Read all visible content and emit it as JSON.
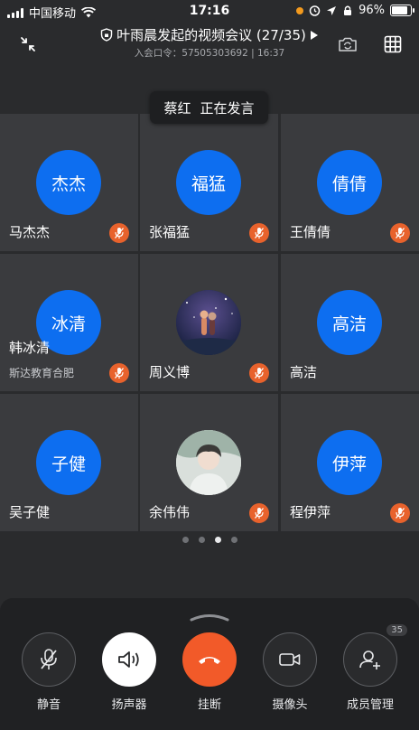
{
  "status_bar": {
    "carrier": "中国移动",
    "time": "17:16",
    "battery": "96%",
    "battery_level": 0.96
  },
  "header": {
    "title": "叶雨晨发起的视频会议 (27/35)",
    "subtitle": "入会口令：57505303692 | 16:37"
  },
  "speaking_toast": {
    "name": "蔡红",
    "status": "正在发言"
  },
  "participants": [
    {
      "avatar_text": "杰杰",
      "name": "马杰杰",
      "muted": true
    },
    {
      "avatar_text": "福猛",
      "name": "张福猛",
      "muted": true
    },
    {
      "avatar_text": "倩倩",
      "name": "王倩倩",
      "muted": true
    },
    {
      "avatar_text": "冰清",
      "name": "韩冰清",
      "subtitle": "斯达教育合肥",
      "muted": true
    },
    {
      "avatar_text": "",
      "avatar_image": "anime-photo",
      "name": "周义博",
      "muted": true
    },
    {
      "avatar_text": "高洁",
      "name": "高洁",
      "muted": false
    },
    {
      "avatar_text": "子健",
      "name": "吴子健",
      "muted": false
    },
    {
      "avatar_text": "",
      "avatar_image": "photo",
      "name": "余伟伟",
      "muted": true
    },
    {
      "avatar_text": "伊萍",
      "name": "程伊萍",
      "muted": true
    }
  ],
  "pagination": {
    "pages": 4,
    "current": 3
  },
  "controls": {
    "mute_label": "静音",
    "speaker_label": "扬声器",
    "hangup_label": "挂断",
    "camera_label": "摄像头",
    "members_label": "成员管理",
    "members_count": "35"
  },
  "colors": {
    "avatar_blue": "#0d6ef0",
    "mic_badge": "#e8622c",
    "hangup_red": "#f25a29",
    "tile_bg": "#3a3b3e",
    "page_bg": "#2a2b2d"
  },
  "icons": [
    "signal-icon",
    "wifi-icon",
    "alarm-icon",
    "location-icon",
    "lock-icon",
    "battery-icon",
    "collapse-icon",
    "shield-icon",
    "play-icon",
    "camera-switch-icon",
    "grid-icon",
    "mic-muted-icon",
    "mic-off-icon",
    "speaker-icon",
    "hangup-icon",
    "video-camera-icon",
    "add-member-icon"
  ]
}
